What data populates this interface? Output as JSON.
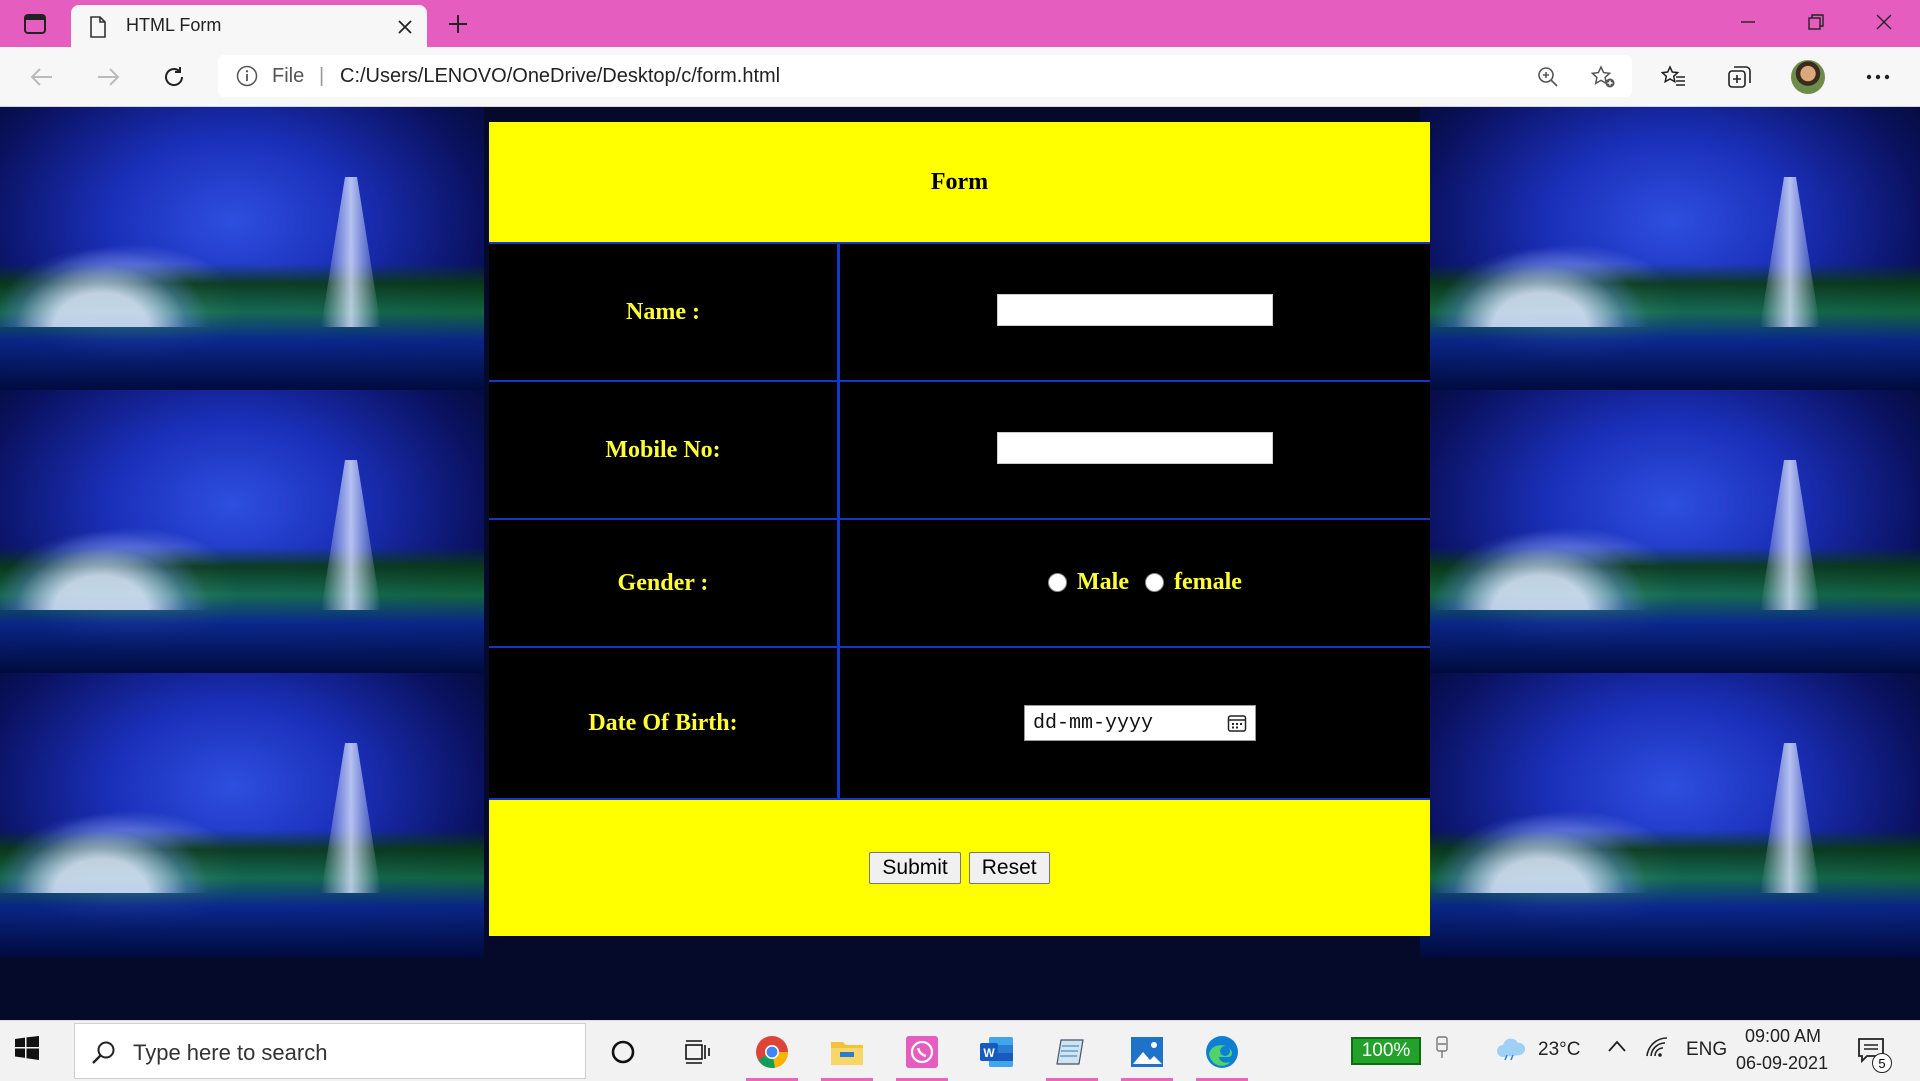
{
  "browser": {
    "tab_title": "HTML Form",
    "url_scheme_label": "File",
    "url": "C:/Users/LENOVO/OneDrive/Desktop/c/form.html"
  },
  "form": {
    "heading": "Form",
    "name_label": "Name :",
    "name_value": "",
    "mobile_label": "Mobile No:",
    "mobile_value": "",
    "gender_label": "Gender :",
    "gender_options": [
      "Male",
      "female"
    ],
    "dob_label": "Date Of Birth:",
    "dob_placeholder": "dd-mm-yyyy",
    "submit_label": "Submit",
    "reset_label": "Reset",
    "colors": {
      "header_bg": "#ffff00",
      "label_text": "#ffff33",
      "cell_bg": "#000000",
      "border": "#1238c9"
    }
  },
  "taskbar": {
    "search_placeholder": "Type here to search",
    "battery": "100%",
    "temperature": "23°C",
    "language": "ENG",
    "time": "09:00 AM",
    "date": "06-09-2021",
    "notification_count": "5",
    "apps": [
      "cortana-icon",
      "task-view-icon",
      "chrome-icon",
      "file-explorer-icon",
      "whatsapp-icon",
      "word-icon",
      "notepad-icon",
      "photos-icon",
      "edge-icon"
    ]
  },
  "colors": {
    "titlebar": "#e55ebf"
  }
}
